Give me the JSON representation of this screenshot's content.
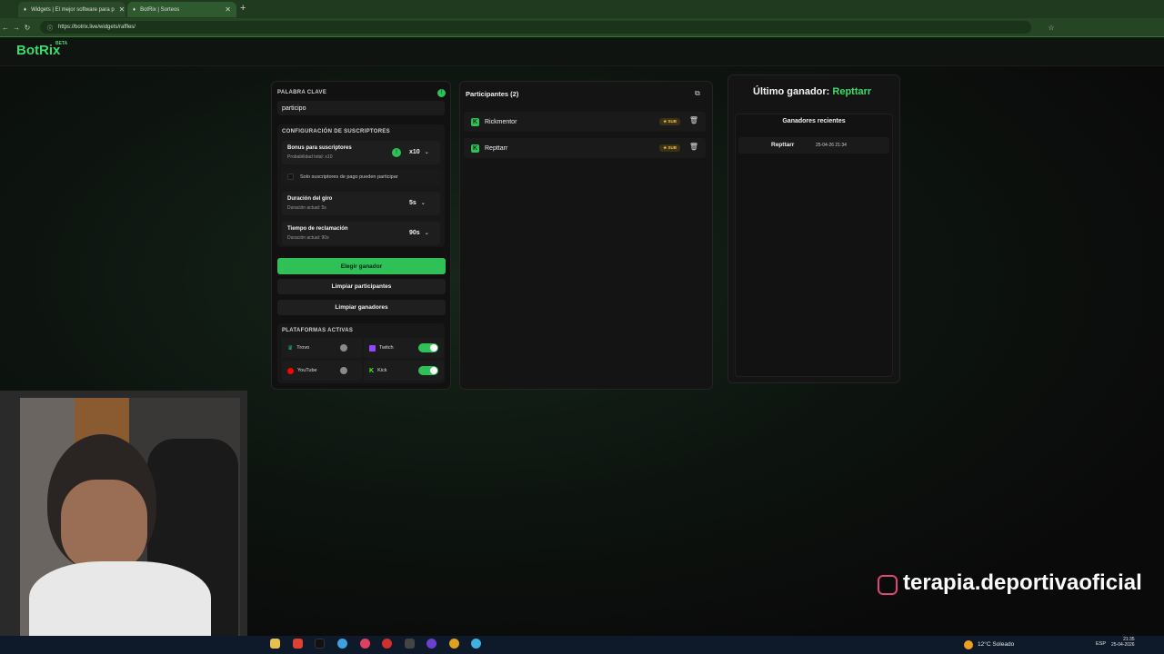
{
  "browser": {
    "tabs": [
      {
        "label": "Widgets | El mejor software para p"
      },
      {
        "label": "BotRix | Sorteos"
      }
    ],
    "url": "https://botrix.live/widgets/raffles/"
  },
  "app": {
    "logo": "BotRix",
    "badge": "BETA"
  },
  "left_panel": {
    "keyword_label": "PALABRA CLAVE",
    "keyword_value": "participo",
    "subs_config_label": "CONFIGURACIÓN DE SUSCRIPTORES",
    "bonus_title": "Bonus para suscriptores",
    "bonus_sub": "Probabilidad total: x10",
    "bonus_value": "x10",
    "only_paid_label": "Solo suscriptores de pago pueden participar",
    "spin_title": "Duración del giro",
    "spin_sub": "Duración actual: 5s",
    "spin_value": "5s",
    "claim_title": "Tiempo de reclamación",
    "claim_sub": "Duración actual: 90s",
    "claim_value": "90s",
    "choose_winner": "Elegir ganador",
    "clear_participants": "Limpiar participantes",
    "clear_winners": "Limpiar ganadores",
    "platforms_label": "PLATAFORMAS ACTIVAS",
    "platforms": [
      {
        "name": "Trovo",
        "enabled": false,
        "color": "#1ab86b"
      },
      {
        "name": "Twitch",
        "enabled": true,
        "color": "#9146ff"
      },
      {
        "name": "YouTube",
        "enabled": false,
        "color": "#ff0000"
      },
      {
        "name": "Kick",
        "enabled": true,
        "color": "#53fc18"
      }
    ]
  },
  "middle_panel": {
    "title": "Participantes (2)",
    "participants": [
      {
        "name": "Rickmentor",
        "badge": "SUB"
      },
      {
        "name": "Repttarr",
        "badge": "SUB"
      }
    ]
  },
  "right_panel": {
    "last_winner_label": "Último ganador:",
    "last_winner_name": "Repttarr",
    "recent_title": "Ganadores recientes",
    "recent": [
      {
        "name": "Repttarr",
        "date": "25-04-26 21:34"
      }
    ]
  },
  "overlay": {
    "social": "terapia.deportivaoficial"
  },
  "taskbar": {
    "weather": "12°C Soleado",
    "lang": "ESP",
    "time": "21:35",
    "date": "25-04-2026"
  },
  "colors": {
    "accent": "#2fc058",
    "brand_green": "#3ddc6a"
  }
}
